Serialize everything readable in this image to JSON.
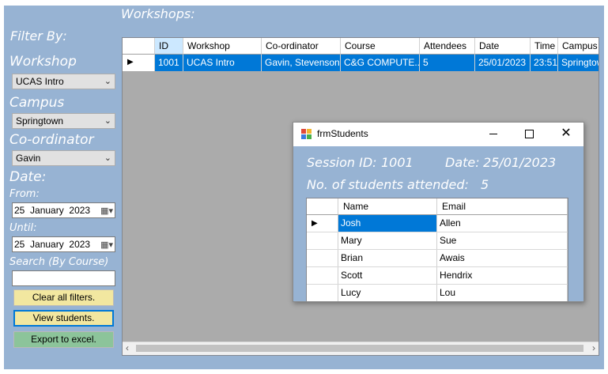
{
  "workshops_label": "Workshops:",
  "filter": {
    "heading": "Filter By:",
    "workshop_label": "Workshop",
    "workshop_value": "UCAS Intro",
    "campus_label": "Campus",
    "campus_value": "Springtown",
    "coordinator_label": "Co-ordinator",
    "coordinator_value": "Gavin",
    "date_label": "Date:",
    "from_label": "From:",
    "from_value": {
      "day": "25",
      "month": "January",
      "year": "2023"
    },
    "until_label": "Until:",
    "until_value": {
      "day": "25",
      "month": "January",
      "year": "2023"
    },
    "search_label": "Search (By Course)",
    "search_value": ""
  },
  "buttons": {
    "clear": "Clear all filters.",
    "view": "View students.",
    "export": "Export to excel."
  },
  "grid": {
    "columns": [
      "ID",
      "Workshop",
      "Co-ordinator",
      "Course",
      "Attendees",
      "Date",
      "Time",
      "Campus"
    ],
    "rows": [
      [
        "1001",
        "UCAS Intro",
        "Gavin, Stevenson",
        "C&G COMPUTE...",
        "5",
        "25/01/2023",
        "23:51",
        "Springtown"
      ]
    ]
  },
  "dialog": {
    "title": "frmStudents",
    "session_label": "Session ID:",
    "session_id": "1001",
    "date_label": "Date:",
    "date_value": "25/01/2023",
    "attended_label": "No. of students attended:",
    "attended_count": "5",
    "columns": [
      "Name",
      "Email"
    ],
    "rows": [
      [
        "Josh",
        "Allen"
      ],
      [
        "Mary",
        "Sue"
      ],
      [
        "Brian",
        "Awais"
      ],
      [
        "Scott",
        "Hendrix"
      ],
      [
        "Lucy",
        "Lou"
      ]
    ]
  },
  "colors": {
    "panel": "#97b3d3",
    "selection": "#0078d7",
    "button_yellow": "#f2e7a0",
    "button_green": "#8cc49a"
  }
}
